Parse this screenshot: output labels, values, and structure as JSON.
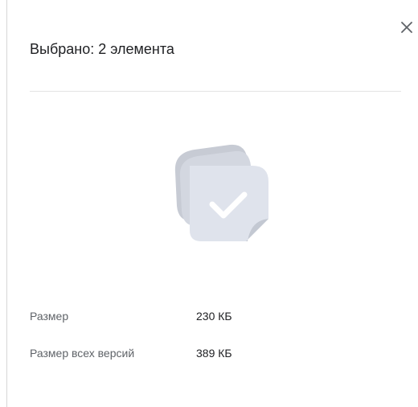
{
  "panel": {
    "title": "Выбрано: 2 элемента",
    "close_icon": "close-icon",
    "illustration_icon": "multi-selection-check-icon"
  },
  "details": {
    "size_label": "Размер",
    "size_value": "230 КБ",
    "all_versions_label": "Размер всех версий",
    "all_versions_value": "389 КБ"
  },
  "colors": {
    "sheet_back": "#c7cbd4",
    "sheet_front": "#dfe3ec",
    "check": "#ffffff",
    "divider": "#e4e4e4"
  }
}
